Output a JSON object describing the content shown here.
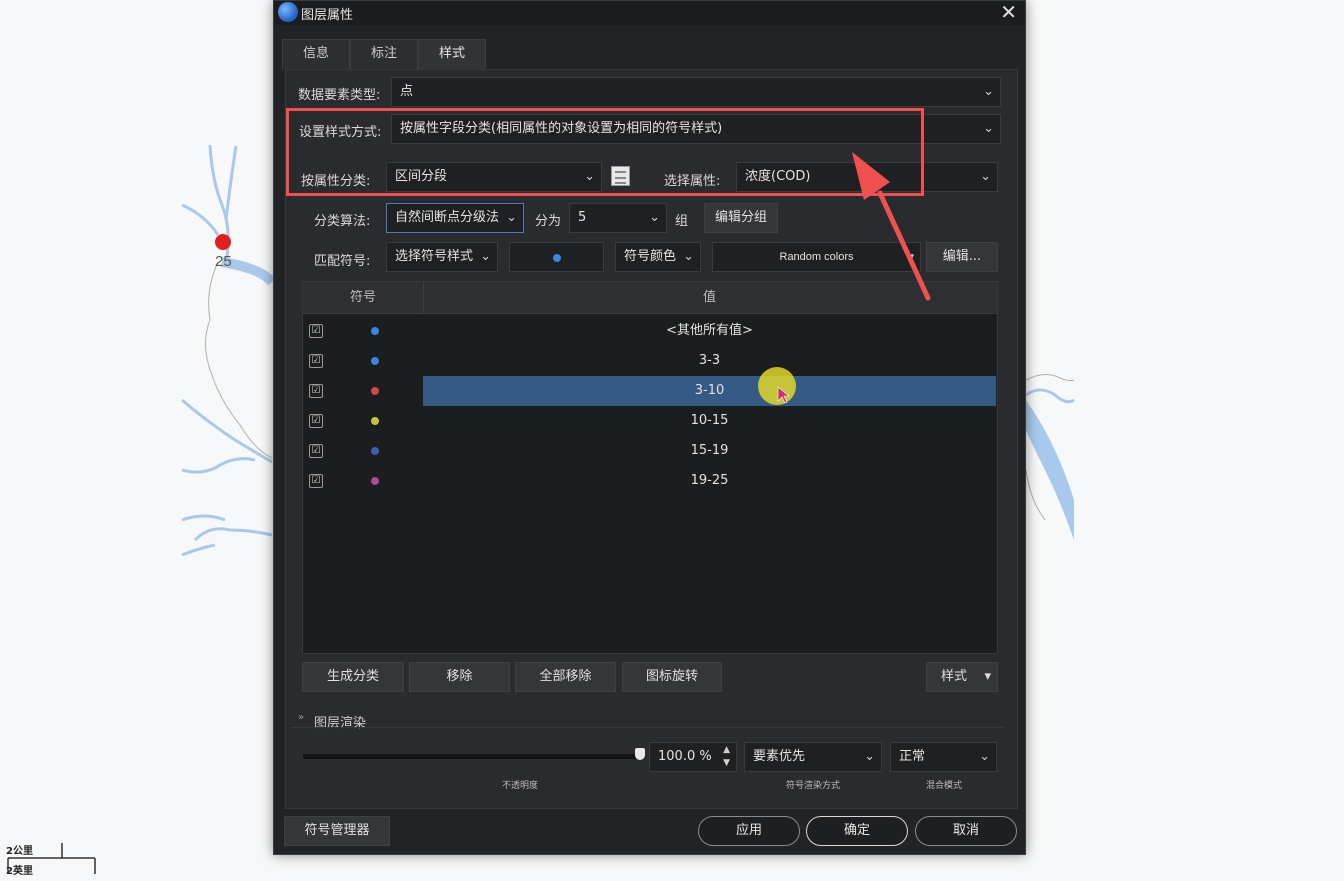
{
  "map": {
    "point_label": "25",
    "point_color": "#e02020",
    "river_color": "#a9c9ec",
    "scale_top": "2公里",
    "scale_bottom": "2英里"
  },
  "dialog": {
    "title": "图层属性",
    "close_icon": "close-icon",
    "tabs": [
      "信息",
      "标注",
      "样式"
    ],
    "active_tab": "样式",
    "data_type_label": "数据要素类型:",
    "data_type_value": "点",
    "style_mode_label": "设置样式方式:",
    "style_mode_value": "按属性字段分类(相同属性的对象设置为相同的符号样式)",
    "classify_by_label": "按属性分类:",
    "classify_by_value": "区间分段",
    "select_attr_label": "选择属性:",
    "select_attr_value": "浓度(COD)",
    "algorithm_label": "分类算法:",
    "algorithm_value": "自然间断点分级法",
    "divide_label": "分为",
    "divide_value": "5",
    "group_label": "组",
    "edit_group_button": "编辑分组",
    "match_symbol_label": "匹配符号:",
    "symbol_style_value": "选择符号样式",
    "symbol_color_value": "符号颜色",
    "color_scheme_value": "Random colors",
    "edit_button": "编辑...",
    "table": {
      "col_symbol": "符号",
      "col_value": "值",
      "rows": [
        {
          "value": "<其他所有值>",
          "color": "#3a86e0",
          "checked": "☑"
        },
        {
          "value": "3-3",
          "color": "#3a86e0",
          "checked": "☑"
        },
        {
          "value": "3-10",
          "color": "#d24848",
          "checked": "☑"
        },
        {
          "value": "10-15",
          "color": "#c9c33a",
          "checked": "☑"
        },
        {
          "value": "15-19",
          "color": "#3f5fae",
          "checked": "☑"
        },
        {
          "value": "19-25",
          "color": "#a84a9e",
          "checked": "☑"
        }
      ],
      "selected_row": "3-10"
    },
    "buttons": {
      "generate": "生成分类",
      "remove": "移除",
      "remove_all": "全部移除",
      "rotate": "图标旋转",
      "style": "样式"
    },
    "render": {
      "section_title": "图层渲染",
      "opacity_value": "100.0 %",
      "opacity_caption": "不透明度",
      "render_order_value": "要素优先",
      "render_order_caption": "符号渲染方式",
      "blend_value": "正常",
      "blend_caption": "混合模式",
      "opacity_level": 1.0
    },
    "footer": {
      "symbol_manager": "符号管理器",
      "apply": "应用",
      "ok": "确定",
      "cancel": "取消"
    }
  },
  "annotation": {
    "highlight_color": "#f05050"
  }
}
